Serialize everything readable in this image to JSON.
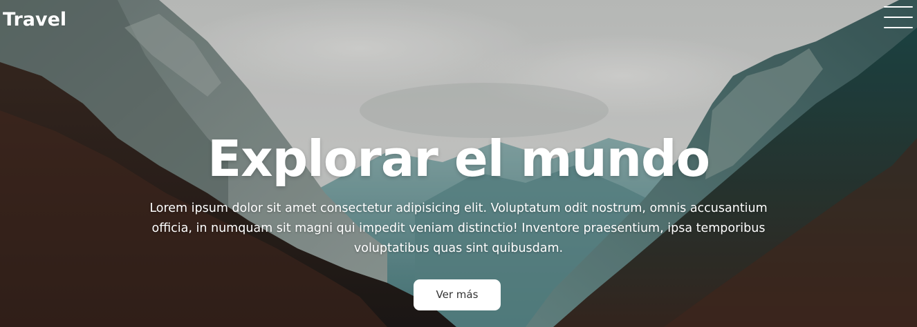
{
  "header": {
    "brand": "Travel",
    "menu_icon": "hamburger-menu-icon"
  },
  "hero": {
    "background": "mountain-valley-photo",
    "title": "Explorar el mundo",
    "text": "Lorem ipsum dolor sit amet consectetur adipisicing elit. Voluptatum odit nostrum, omnis accusantium officia, in numquam sit magni qui impedit veniam distinctio! Inventore praesentium, ipsa temporibus voluptatibus quas sint quibusdam.",
    "button_label": "Ver más"
  },
  "colors": {
    "text": "#ffffff",
    "button_bg": "#ffffff",
    "button_text": "#333333"
  }
}
